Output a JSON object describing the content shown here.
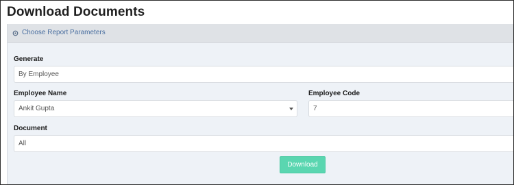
{
  "page": {
    "title": "Download Documents"
  },
  "panel": {
    "header_label": "Choose Report Parameters",
    "header_icon": "cog-icon"
  },
  "form": {
    "generate": {
      "label": "Generate",
      "value": "By Employee"
    },
    "employee_name": {
      "label": "Employee Name",
      "value": "Ankit Gupta"
    },
    "employee_code": {
      "label": "Employee Code",
      "value": "7"
    },
    "document": {
      "label": "Document",
      "value": "All"
    },
    "download_label": "Download"
  },
  "colors": {
    "accent": "#5ad6b0",
    "header_text": "#4a6fa0"
  }
}
